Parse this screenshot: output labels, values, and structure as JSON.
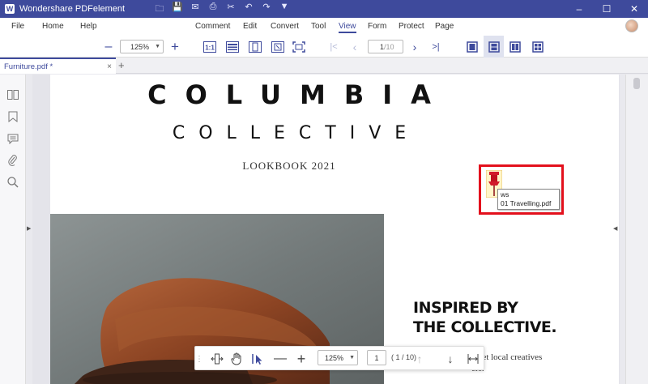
{
  "app": {
    "title": "Wondershare PDFelement"
  },
  "window_controls": {
    "minimize": "–",
    "maximize": "☐",
    "close": "✕"
  },
  "menu": {
    "left": [
      "File",
      "Home",
      "Help"
    ],
    "center": [
      "Comment",
      "Edit",
      "Convert",
      "Tool",
      "View",
      "Form",
      "Protect",
      "Page"
    ],
    "active": "View"
  },
  "toolbar": {
    "zoom_out": "–",
    "zoom_value": "125%",
    "zoom_in": "+",
    "page_current": "1",
    "page_total": "/10"
  },
  "tab": {
    "label": "Furniture.pdf *",
    "close": "×",
    "new": "+"
  },
  "document": {
    "title_line1": "COLUMBIA",
    "title_line2": "COLLECTIVE",
    "subtitle": "LOOKBOOK 2021",
    "heading_line1": "INSPIRED BY",
    "heading_line2": "THE COLLECTIVE.",
    "body_line1": "meet local creatives",
    "body_line2": "ers."
  },
  "annotation": {
    "author": "ws",
    "attachment": "01 Travelling.pdf",
    "highlight_color": "#e3101c"
  },
  "float_toolbar": {
    "zoom_value": "125%",
    "page_current": "1",
    "page_total": "( 1 / 10)"
  },
  "colors": {
    "accent": "#3e4a9c",
    "annotation_border": "#e3101c",
    "pin": "#d11a2a"
  }
}
